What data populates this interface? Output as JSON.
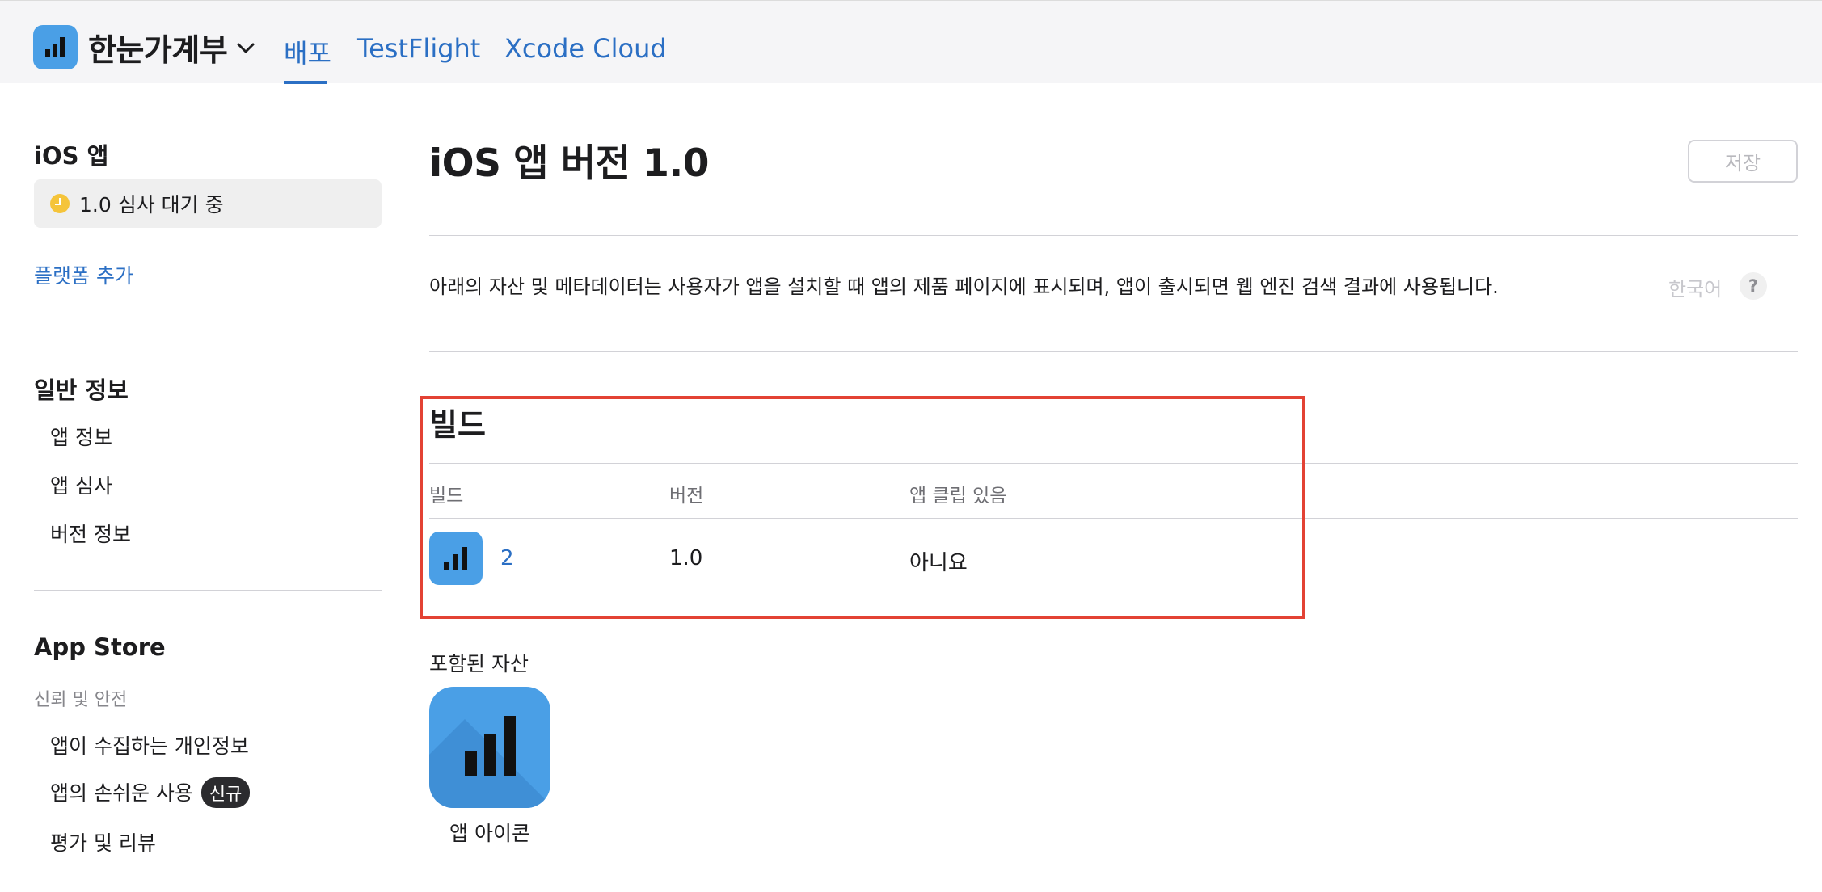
{
  "topbar": {
    "app_name": "한눈가계부",
    "tabs": [
      {
        "label": "배포",
        "active": true
      },
      {
        "label": "TestFlight",
        "active": false
      },
      {
        "label": "Xcode Cloud",
        "active": false
      }
    ]
  },
  "sidebar": {
    "ios_heading": "iOS 앱",
    "version_status": "1.0 심사 대기 중",
    "add_platform": "플랫폼 추가",
    "general_heading": "일반 정보",
    "general_items": [
      "앱 정보",
      "앱 심사",
      "버전 정보"
    ],
    "appstore_heading": "App Store",
    "trust_label": "신뢰 및 안전",
    "appstore_items": [
      "앱이 수집하는 개인정보",
      "앱의 손쉬운 사용",
      "평가 및 리뷰"
    ],
    "new_badge": "신규"
  },
  "main": {
    "title": "iOS 앱 버전 1.0",
    "save_label": "저장",
    "description": "아래의 자산 및 메타데이터는 사용자가 앱을 설치할 때 앱의 제품 페이지에 표시되며, 앱이 출시되면 웹 엔진 검색 결과에 사용됩니다.",
    "language": "한국어",
    "help_label": "?",
    "build_heading": "빌드",
    "columns": [
      "빌드",
      "버전",
      "앱 클립 있음"
    ],
    "build_row": {
      "build": "2",
      "version": "1.0",
      "app_clip": "아니요"
    },
    "assets_heading": "포함된 자산",
    "app_icon_caption": "앱 아이콘"
  },
  "colors": {
    "accent": "#2b6fc4",
    "icon_blue": "#4a9fe6",
    "highlight": "#e34234",
    "pending": "#f5c43a"
  }
}
